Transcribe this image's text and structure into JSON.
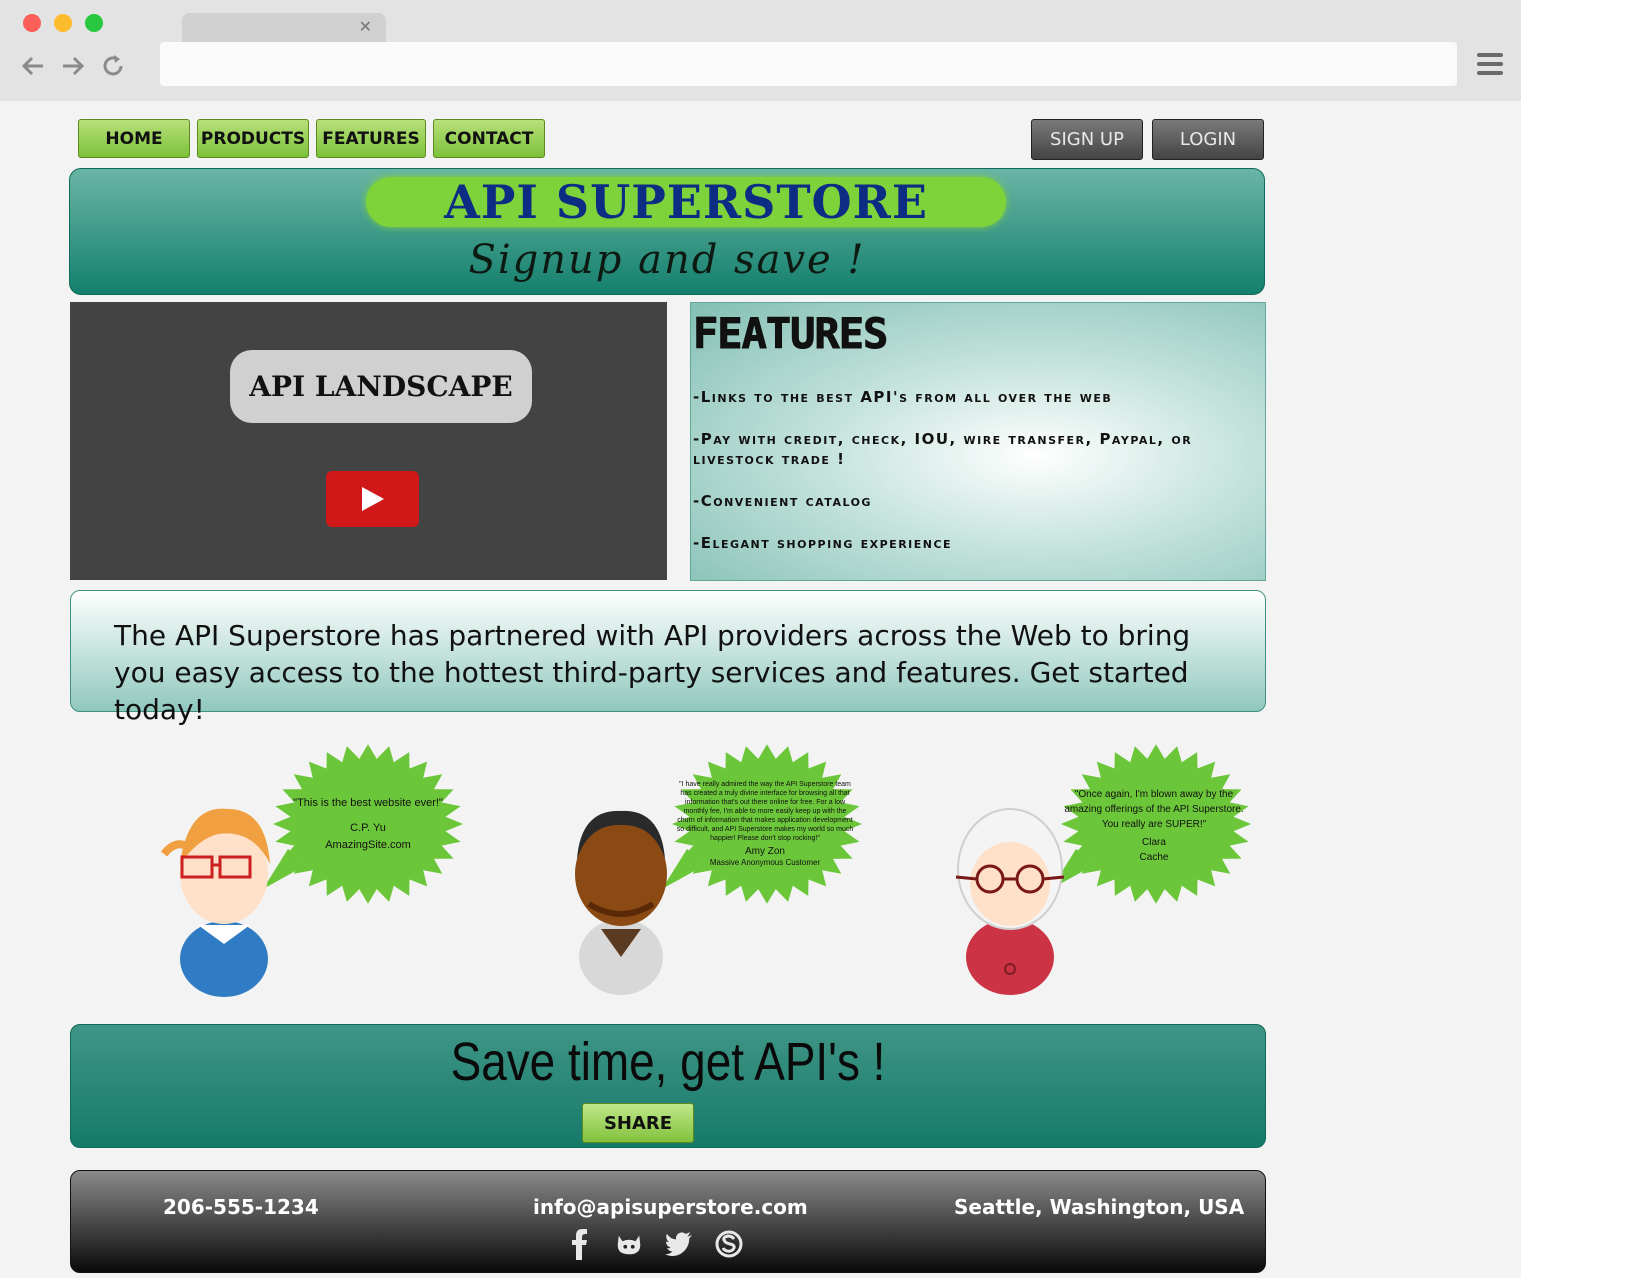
{
  "nav": {
    "items": [
      "HOME",
      "PRODUCTS",
      "FEATURES",
      "CONTACT"
    ]
  },
  "auth": {
    "signup": "SIGN UP",
    "login": "LOGIN"
  },
  "hero": {
    "title": "API SUPERSTORE",
    "subtitle": "Signup and save !"
  },
  "video": {
    "label": "API LANDSCAPE"
  },
  "features": {
    "title": "FEATURES",
    "items": [
      "-Links to the best API's from all over the web",
      "-Pay with credit, check, IOU, wire transfer, Paypal, or livestock trade !",
      "-Convenient catalog",
      "-Elegant shopping experience"
    ]
  },
  "intro": {
    "text": "The API Superstore has partnered with API providers across the Web to bring you easy access to the hottest third-party services and features. Get started today!"
  },
  "testimonials": [
    {
      "quote": "\"This is the best website ever!\"",
      "name": "C.P. Yu",
      "company": "AmazingSite.com"
    },
    {
      "quote": "\"I have really admired the way the API Superstore team has created a truly divine interface for browsing all that information that's out there online for free. For a low monthly fee, I'm able to more easily keep up with the churn of information that makes application development so difficult, and API Superstore makes my world so much happier! Please don't stop rocking!\"",
      "name": "Amy Zon",
      "company": "Massive Anonymous Customer"
    },
    {
      "quote": "\"Once again, I'm blown away by the amazing offerings of the API Superstore. You really are SUPER!\"",
      "name": "Clara",
      "company": "Cache"
    }
  ],
  "cta": {
    "title": "Save time, get API's !",
    "share": "SHARE"
  },
  "footer": {
    "phone": "206-555-1234",
    "email": "info@apisuperstore.com",
    "location": "Seattle, Washington, USA"
  },
  "socials": [
    "facebook-icon",
    "github-icon",
    "twitter-icon",
    "skype-icon"
  ],
  "colors": {
    "accent_green": "#7cc13a",
    "teal": "#14806d",
    "title_blue": "#0d2c84",
    "play_red": "#d01818"
  }
}
